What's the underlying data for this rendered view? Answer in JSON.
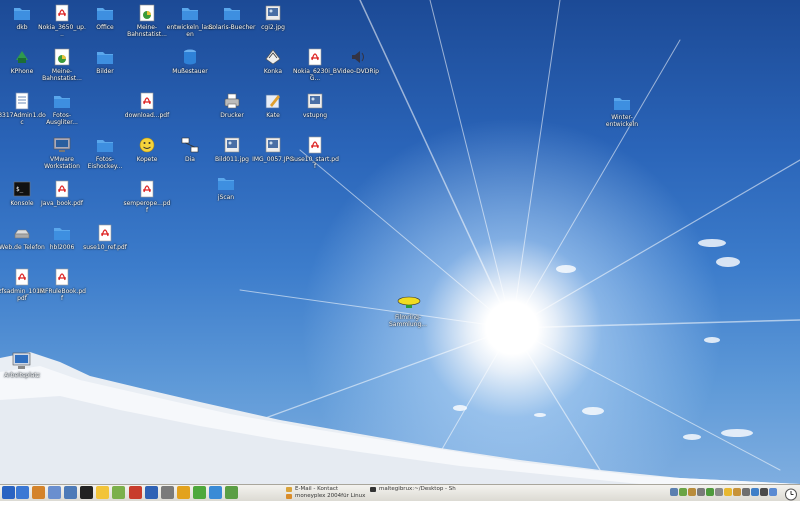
{
  "desktop": {
    "icons": [
      {
        "label": "dkb",
        "type": "folder"
      },
      {
        "label": "Nokia_3650_up...",
        "type": "pdf"
      },
      {
        "label": "Office",
        "type": "folder"
      },
      {
        "label": "Meine-Bahnstatist...",
        "type": "chart"
      },
      {
        "label": "entwickeln_lassen",
        "type": "folder"
      },
      {
        "label": "Solaris-Buecher",
        "type": "folder"
      },
      {
        "label": "cgi2.jpg",
        "type": "image"
      },
      {
        "label": "KPhone",
        "type": "phone"
      },
      {
        "label": "Meine-Bahnstatist...",
        "type": "chart"
      },
      {
        "label": "Bilder",
        "type": "folder"
      },
      {
        "label": "Mußestauer",
        "type": "database"
      },
      {
        "label": "Konka",
        "type": "scanner"
      },
      {
        "label": "Nokia_6230i_BG...",
        "type": "pdf"
      },
      {
        "label": "Video-DVDRip",
        "type": "speaker"
      },
      {
        "label": "3317Admin1.doc",
        "type": "doc"
      },
      {
        "label": "Fotos-Ausgliter...",
        "type": "folder"
      },
      {
        "label": "download...pdf",
        "type": "pdf"
      },
      {
        "label": "Drucker",
        "type": "printer"
      },
      {
        "label": "Kate",
        "type": "editor"
      },
      {
        "label": "vstupng",
        "type": "image"
      },
      {
        "label": "Winter-entwickeln",
        "type": "folder"
      },
      {
        "label": "VMware Workstation",
        "type": "vmware"
      },
      {
        "label": "Fotos-Eishockey...",
        "type": "folder"
      },
      {
        "label": "Kopete",
        "type": "smiley"
      },
      {
        "label": "Dia",
        "type": "dia"
      },
      {
        "label": "Bild011.jpg",
        "type": "image"
      },
      {
        "label": "IMG_0057.JPG",
        "type": "image"
      },
      {
        "label": "suse10_start.pdf",
        "type": "pdf"
      },
      {
        "label": "Konsole",
        "type": "terminal"
      },
      {
        "label": "Java_book.pdf",
        "type": "pdf"
      },
      {
        "label": "semperope...pdf",
        "type": "pdf"
      },
      {
        "label": "jScan",
        "type": "folder"
      },
      {
        "label": "Web.de Telefon",
        "type": "drive"
      },
      {
        "label": "hbl2006",
        "type": "folder"
      },
      {
        "label": "suse10_ref.pdf",
        "type": "pdf"
      },
      {
        "label": "zfsadmin_1016.pdf",
        "type": "pdf"
      },
      {
        "label": "IMFRuleBook.pdf",
        "type": "pdf"
      },
      {
        "label": "Filmring-Sammlung...",
        "type": "blimp"
      },
      {
        "label": "Arbeitsplatz",
        "type": "computer"
      }
    ]
  },
  "taskbar": {
    "launchers": [
      {
        "name": "kmenu-icon",
        "color": "#2a63c2"
      },
      {
        "name": "desktop-icon",
        "color": "#3b78d4"
      },
      {
        "name": "home-icon",
        "color": "#d4832a"
      },
      {
        "name": "mail-icon",
        "color": "#6a8fcf"
      },
      {
        "name": "network-icon",
        "color": "#4d7ab8"
      },
      {
        "name": "terminal-icon",
        "color": "#222222"
      },
      {
        "name": "kopete-icon",
        "color": "#f2c43a"
      },
      {
        "name": "media-icon",
        "color": "#7bb04a"
      },
      {
        "name": "calendar-icon",
        "color": "#c83c2c"
      },
      {
        "name": "browser-icon",
        "color": "#2f62b5"
      },
      {
        "name": "sound-icon",
        "color": "#7a7a7a"
      },
      {
        "name": "star-icon",
        "color": "#e3a21d"
      },
      {
        "name": "chat-icon",
        "color": "#4ea83c"
      },
      {
        "name": "globe-icon",
        "color": "#3a8bd6"
      },
      {
        "name": "editor-icon",
        "color": "#5a9e44"
      }
    ],
    "tasks": [
      {
        "label": "E-Mail - Kontact",
        "color": "#d9a33b"
      },
      {
        "label": "maltegibrux:~/Desktop - Sh",
        "color": "#333333"
      },
      {
        "label": "moneyplex 2004für Linux",
        "color": "#d98c2a"
      }
    ],
    "tray": [
      {
        "name": "tray-network-icon",
        "color": "#5b7fb0"
      },
      {
        "name": "tray-update-icon",
        "color": "#6aa446"
      },
      {
        "name": "tray-clipboard-icon",
        "color": "#b98c3b"
      },
      {
        "name": "tray-volume-icon",
        "color": "#7a7a7a"
      },
      {
        "name": "tray-battery-icon",
        "color": "#4f9a3d"
      },
      {
        "name": "tray-printer-icon",
        "color": "#8a8a8a"
      },
      {
        "name": "tray-kopete-icon",
        "color": "#e8b830"
      },
      {
        "name": "tray-mail-icon",
        "color": "#c79238"
      },
      {
        "name": "tray-keyboard-icon",
        "color": "#6f6f6f"
      },
      {
        "name": "tray-web-icon",
        "color": "#3f7fc8"
      },
      {
        "name": "tray-power-icon",
        "color": "#4a4a4a"
      },
      {
        "name": "tray-wifi-icon",
        "color": "#5a8ad2"
      }
    ]
  }
}
